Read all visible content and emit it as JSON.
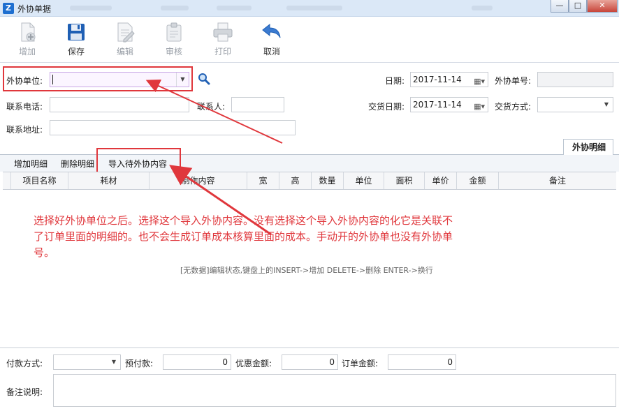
{
  "window": {
    "title": "外协单据",
    "app_icon": "Z",
    "controls": [
      "—",
      "□",
      "✕"
    ]
  },
  "toolbar": {
    "buttons": [
      {
        "label": "增加",
        "icon": "add-document-icon",
        "enabled": false
      },
      {
        "label": "保存",
        "icon": "floppy-disk-icon",
        "enabled": true
      },
      {
        "label": "编辑",
        "icon": "edit-document-icon",
        "enabled": false
      },
      {
        "label": "审核",
        "icon": "clipboard-icon",
        "enabled": false
      },
      {
        "label": "打印",
        "icon": "printer-icon",
        "enabled": false
      },
      {
        "label": "取消",
        "icon": "undo-arrow-icon",
        "enabled": true
      }
    ]
  },
  "form": {
    "vendor_label": "外协单位:",
    "vendor_value": "",
    "date_label": "日期:",
    "date_value": "2017-11-14",
    "order_no_label": "外协单号:",
    "order_no_value": "",
    "phone_label": "联系电话:",
    "phone_value": "",
    "contact_label": "联系人:",
    "contact_value": "",
    "delivery_date_label": "交货日期:",
    "delivery_date_value": "2017-11-14",
    "delivery_method_label": "交货方式:",
    "delivery_method_value": "",
    "address_label": "联系地址:",
    "address_value": ""
  },
  "tabs": {
    "active": "外协明细"
  },
  "detail_actions": {
    "add": "增加明细",
    "delete": "删除明细",
    "import": "导入待外协内容"
  },
  "grid": {
    "columns": [
      "项目名称",
      "耗材",
      "制作内容",
      "宽",
      "高",
      "数量",
      "单位",
      "面积",
      "单价",
      "金额",
      "备注"
    ],
    "empty_hint": "[无数据]编辑状态,键盘上的INSERT->增加 DELETE->删除 ENTER->换行"
  },
  "annotation": {
    "text": "选择好外协单位之后。选择这个导入外协内容。没有选择这个导入外协内容的化它是关联不了订单里面的明细的。也不会生成订单成本核算里面的成本。手动开的外协单也没有外协单号。",
    "color": "#e0373c"
  },
  "footer": {
    "payment_label": "付款方式:",
    "payment_value": "",
    "prepay_label": "预付款:",
    "prepay_value": "0",
    "discount_label": "优惠金额:",
    "discount_value": "0",
    "order_amount_label": "订单金额:",
    "order_amount_value": "0",
    "remark_label": "备注说明:",
    "remark_value": ""
  }
}
